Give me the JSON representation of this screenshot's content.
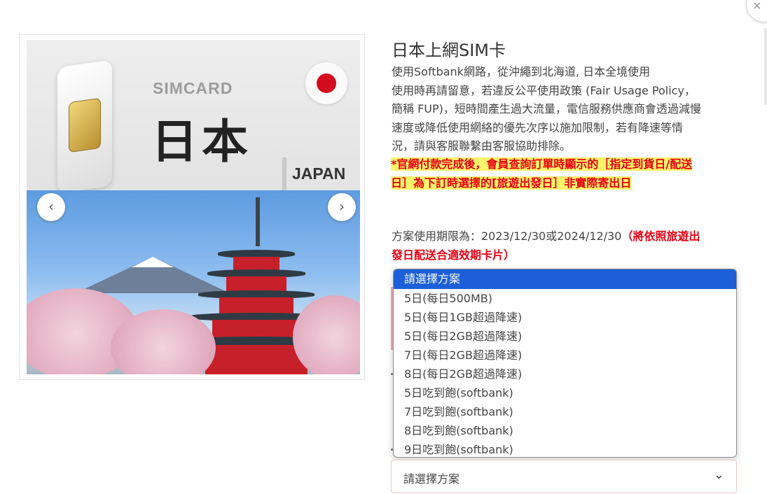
{
  "close_icon": "close-icon",
  "product": {
    "image_text": {
      "simcard": "SIMCARD",
      "kanji": "日本",
      "japan": "JAPAN"
    },
    "carousel": {
      "prev_icon": "chevron-left-icon",
      "next_icon": "chevron-right-icon",
      "prev_glyph": "‹",
      "next_glyph": "›"
    },
    "title": "日本上網SIM卡",
    "description": [
      "使用Softbank網路，從沖繩到北海道, 日本全境使用",
      "使用時再請留意，若違反公平使用政策 (Fair Usage Policy，",
      "簡稱 FUP)，短時間產生過大流量，電信服務供應商會透過減慢",
      "速度或降低使用網絡的優先次序以施加限制，若有降速等情",
      "況，請與客服聯繫由客服協助排除。"
    ],
    "notice": [
      "*官網付款完成後，會員查詢訂單時顯示的［指定到貨日/配送",
      "日］為下訂時選擇的[旅遊出發日］非實際寄出日"
    ],
    "validity_label": "方案使用期限為：2023/12/30或2024/12/30",
    "validity_note_1": "（將依照旅遊出",
    "validity_note_2": "發日配送合適效期卡片）",
    "colors": {
      "accent_red": "#e60012",
      "highlight_yellow": "#fff36b",
      "dropdown_selected": "#1c5fd8"
    }
  },
  "plan_dropdown": {
    "options": [
      "請選擇方案",
      "5日(每日500MB)",
      "5日(每日1GB超過降速)",
      "5日(每日2GB超過降速)",
      "7日(每日2GB超過降速)",
      "8日(每日2GB超過降速)",
      "5日吃到飽(softbank)",
      "7日吃到飽(softbank)",
      "8日吃到飽(softbank)",
      "9日吃到飽(softbank)"
    ],
    "selected_index": 0,
    "select_value": "請選擇方案",
    "chevron_icon": "chevron-down-icon",
    "chevron_glyph": "⌄"
  }
}
